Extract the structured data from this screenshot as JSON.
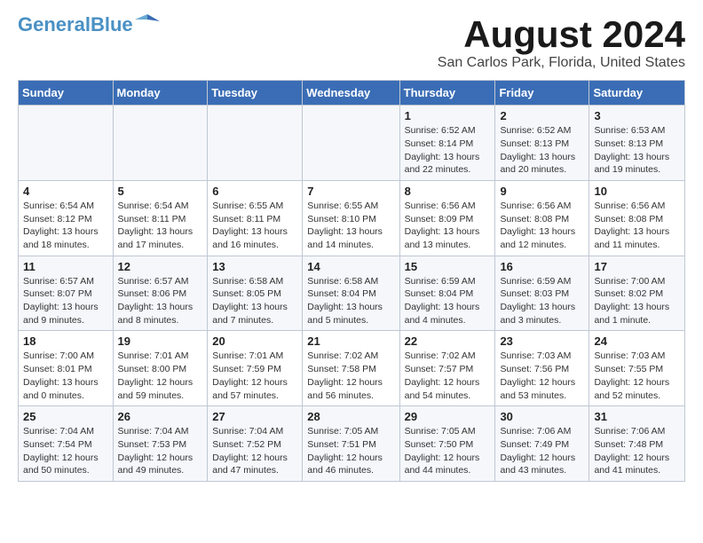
{
  "header": {
    "logo_line1": "General",
    "logo_line2": "Blue",
    "title": "August 2024",
    "subtitle": "San Carlos Park, Florida, United States"
  },
  "days_of_week": [
    "Sunday",
    "Monday",
    "Tuesday",
    "Wednesday",
    "Thursday",
    "Friday",
    "Saturday"
  ],
  "weeks": [
    [
      {
        "day": "",
        "info": ""
      },
      {
        "day": "",
        "info": ""
      },
      {
        "day": "",
        "info": ""
      },
      {
        "day": "",
        "info": ""
      },
      {
        "day": "1",
        "info": "Sunrise: 6:52 AM\nSunset: 8:14 PM\nDaylight: 13 hours\nand 22 minutes."
      },
      {
        "day": "2",
        "info": "Sunrise: 6:52 AM\nSunset: 8:13 PM\nDaylight: 13 hours\nand 20 minutes."
      },
      {
        "day": "3",
        "info": "Sunrise: 6:53 AM\nSunset: 8:13 PM\nDaylight: 13 hours\nand 19 minutes."
      }
    ],
    [
      {
        "day": "4",
        "info": "Sunrise: 6:54 AM\nSunset: 8:12 PM\nDaylight: 13 hours\nand 18 minutes."
      },
      {
        "day": "5",
        "info": "Sunrise: 6:54 AM\nSunset: 8:11 PM\nDaylight: 13 hours\nand 17 minutes."
      },
      {
        "day": "6",
        "info": "Sunrise: 6:55 AM\nSunset: 8:11 PM\nDaylight: 13 hours\nand 16 minutes."
      },
      {
        "day": "7",
        "info": "Sunrise: 6:55 AM\nSunset: 8:10 PM\nDaylight: 13 hours\nand 14 minutes."
      },
      {
        "day": "8",
        "info": "Sunrise: 6:56 AM\nSunset: 8:09 PM\nDaylight: 13 hours\nand 13 minutes."
      },
      {
        "day": "9",
        "info": "Sunrise: 6:56 AM\nSunset: 8:08 PM\nDaylight: 13 hours\nand 12 minutes."
      },
      {
        "day": "10",
        "info": "Sunrise: 6:56 AM\nSunset: 8:08 PM\nDaylight: 13 hours\nand 11 minutes."
      }
    ],
    [
      {
        "day": "11",
        "info": "Sunrise: 6:57 AM\nSunset: 8:07 PM\nDaylight: 13 hours\nand 9 minutes."
      },
      {
        "day": "12",
        "info": "Sunrise: 6:57 AM\nSunset: 8:06 PM\nDaylight: 13 hours\nand 8 minutes."
      },
      {
        "day": "13",
        "info": "Sunrise: 6:58 AM\nSunset: 8:05 PM\nDaylight: 13 hours\nand 7 minutes."
      },
      {
        "day": "14",
        "info": "Sunrise: 6:58 AM\nSunset: 8:04 PM\nDaylight: 13 hours\nand 5 minutes."
      },
      {
        "day": "15",
        "info": "Sunrise: 6:59 AM\nSunset: 8:04 PM\nDaylight: 13 hours\nand 4 minutes."
      },
      {
        "day": "16",
        "info": "Sunrise: 6:59 AM\nSunset: 8:03 PM\nDaylight: 13 hours\nand 3 minutes."
      },
      {
        "day": "17",
        "info": "Sunrise: 7:00 AM\nSunset: 8:02 PM\nDaylight: 13 hours\nand 1 minute."
      }
    ],
    [
      {
        "day": "18",
        "info": "Sunrise: 7:00 AM\nSunset: 8:01 PM\nDaylight: 13 hours\nand 0 minutes."
      },
      {
        "day": "19",
        "info": "Sunrise: 7:01 AM\nSunset: 8:00 PM\nDaylight: 12 hours\nand 59 minutes."
      },
      {
        "day": "20",
        "info": "Sunrise: 7:01 AM\nSunset: 7:59 PM\nDaylight: 12 hours\nand 57 minutes."
      },
      {
        "day": "21",
        "info": "Sunrise: 7:02 AM\nSunset: 7:58 PM\nDaylight: 12 hours\nand 56 minutes."
      },
      {
        "day": "22",
        "info": "Sunrise: 7:02 AM\nSunset: 7:57 PM\nDaylight: 12 hours\nand 54 minutes."
      },
      {
        "day": "23",
        "info": "Sunrise: 7:03 AM\nSunset: 7:56 PM\nDaylight: 12 hours\nand 53 minutes."
      },
      {
        "day": "24",
        "info": "Sunrise: 7:03 AM\nSunset: 7:55 PM\nDaylight: 12 hours\nand 52 minutes."
      }
    ],
    [
      {
        "day": "25",
        "info": "Sunrise: 7:04 AM\nSunset: 7:54 PM\nDaylight: 12 hours\nand 50 minutes."
      },
      {
        "day": "26",
        "info": "Sunrise: 7:04 AM\nSunset: 7:53 PM\nDaylight: 12 hours\nand 49 minutes."
      },
      {
        "day": "27",
        "info": "Sunrise: 7:04 AM\nSunset: 7:52 PM\nDaylight: 12 hours\nand 47 minutes."
      },
      {
        "day": "28",
        "info": "Sunrise: 7:05 AM\nSunset: 7:51 PM\nDaylight: 12 hours\nand 46 minutes."
      },
      {
        "day": "29",
        "info": "Sunrise: 7:05 AM\nSunset: 7:50 PM\nDaylight: 12 hours\nand 44 minutes."
      },
      {
        "day": "30",
        "info": "Sunrise: 7:06 AM\nSunset: 7:49 PM\nDaylight: 12 hours\nand 43 minutes."
      },
      {
        "day": "31",
        "info": "Sunrise: 7:06 AM\nSunset: 7:48 PM\nDaylight: 12 hours\nand 41 minutes."
      }
    ]
  ]
}
